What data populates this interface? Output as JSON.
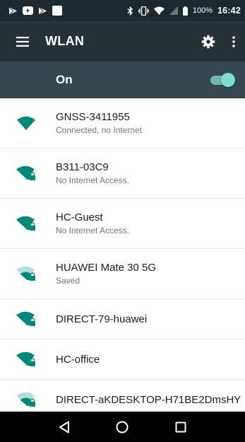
{
  "status_bar": {
    "left_icons": [
      "play-store-notification-icon",
      "youtube-notification-icon",
      "play-store-notification-icon",
      "app-notification-icon"
    ],
    "right_icons": [
      "bluetooth-icon",
      "vibrate-icon",
      "wifi-signal-icon",
      "cell-signal-icon",
      "battery-icon"
    ],
    "battery": "100%",
    "time": "16:42"
  },
  "app_bar": {
    "title": "WLAN",
    "menu_icon": "hamburger-menu-icon",
    "settings_icon": "gear-icon",
    "overflow_icon": "more-vert-icon"
  },
  "master_switch": {
    "label": "On",
    "state": "on",
    "accent_color": "#80cbc4"
  },
  "networks": [
    {
      "name": "GNSS-3411955",
      "status": "Connected, no Internet",
      "secured": false,
      "signal": "full"
    },
    {
      "name": "B311-03C9",
      "status": "No Internet Access.",
      "secured": true,
      "signal": "full"
    },
    {
      "name": "HC-Guest",
      "status": "No Internet Access.",
      "secured": true,
      "signal": "full"
    },
    {
      "name": "HUAWEI Mate 30 5G",
      "status": "Saved",
      "secured": true,
      "signal": "weak"
    },
    {
      "name": "DIRECT-79-huawei",
      "status": "",
      "secured": true,
      "signal": "full"
    },
    {
      "name": "HC-office",
      "status": "",
      "secured": true,
      "signal": "full"
    },
    {
      "name": "DIRECT-aKDESKTOP-H71BE2DmsHY",
      "status": "",
      "secured": true,
      "signal": "weak"
    }
  ],
  "colors": {
    "wifi_icon": "#00897b",
    "wifi_icon_dim": "#80cbc4",
    "app_bar": "#263238",
    "master_row": "#37474f"
  },
  "nav_bar": {
    "back_icon": "back-triangle-icon",
    "home_icon": "home-circle-icon",
    "recents_icon": "recents-square-icon"
  }
}
